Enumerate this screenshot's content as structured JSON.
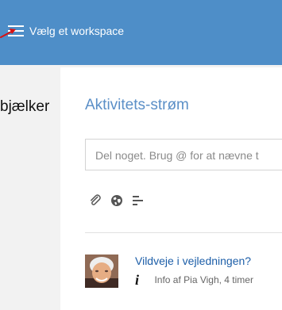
{
  "header": {
    "workspace_label": "Vælg et workspace",
    "menu_icon": "hamburger-menu-icon",
    "background_color": "#4e8ec8"
  },
  "annotation": {
    "label": "bjælker",
    "arrow_color": "#d81212"
  },
  "stream": {
    "title": "Aktivitets-strøm",
    "share_placeholder": "Del noget. Brug @ for at nævne t",
    "toolbar": [
      {
        "icon": "attachment-icon"
      },
      {
        "icon": "globe-icon"
      },
      {
        "icon": "text-align-icon"
      }
    ]
  },
  "feed": {
    "items": [
      {
        "title": "Vildveje i vejledningen?",
        "meta_icon": "info-icon",
        "meta_icon_glyph": "i",
        "meta": "Info af Pia Vigh, 4 timer"
      }
    ]
  }
}
